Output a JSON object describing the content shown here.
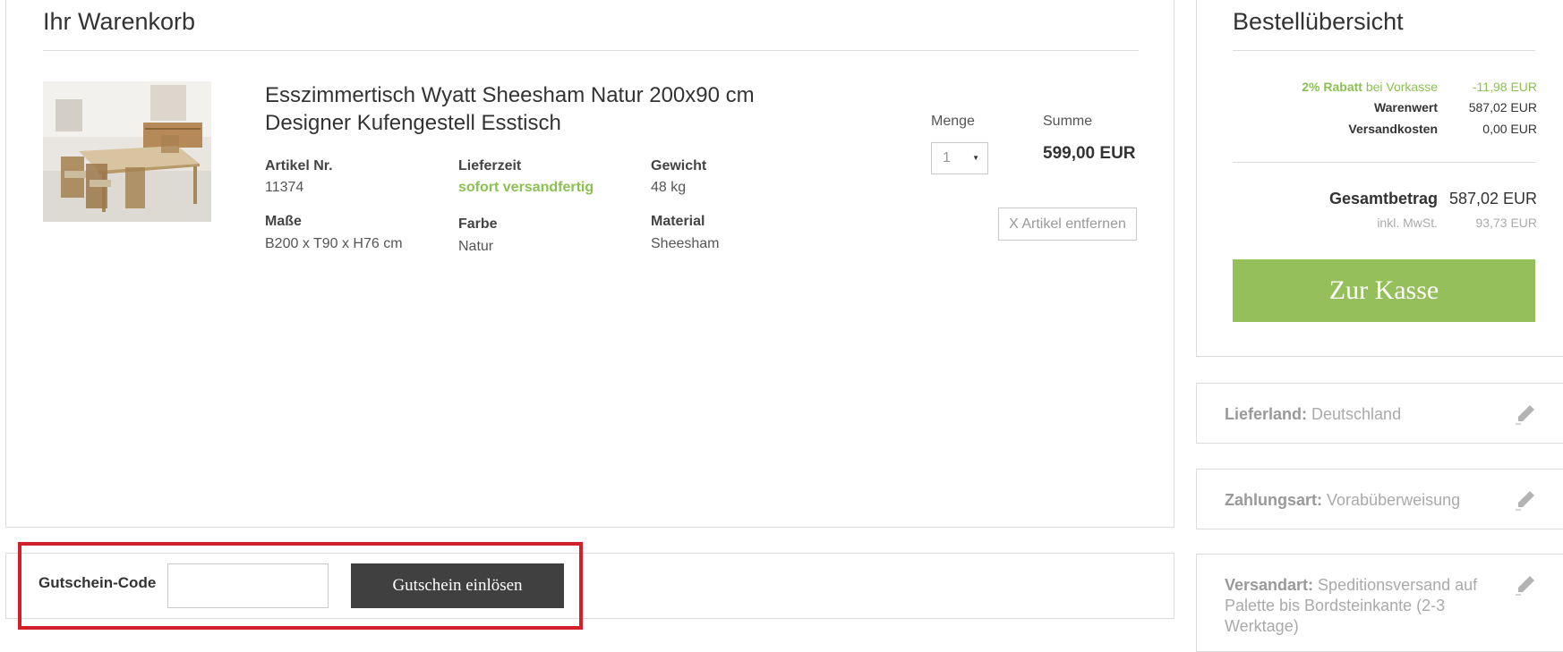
{
  "cart": {
    "title": "Ihr Warenkorb",
    "item": {
      "name": "Esszimmertisch Wyatt Sheesham Natur 200x90 cm Designer Kufengestell Esstisch",
      "attributes": {
        "article_no": {
          "label": "Artikel Nr.",
          "value": "11374"
        },
        "delivery": {
          "label": "Lieferzeit",
          "value": "sofort versandfertig"
        },
        "weight": {
          "label": "Gewicht",
          "value": "48 kg"
        },
        "dimensions": {
          "label": "Maße",
          "value": "B200 x T90 x H76 cm"
        },
        "color": {
          "label": "Farbe",
          "value": "Natur"
        },
        "material": {
          "label": "Material",
          "value": "Sheesham"
        }
      },
      "quantity_label": "Menge",
      "quantity_value": "1",
      "sum_label": "Summe",
      "sum_value": "599,00 EUR",
      "remove_label": "X Artikel entfernen"
    }
  },
  "coupon": {
    "label": "Gutschein-Code",
    "input_value": "",
    "button_label": "Gutschein einlösen"
  },
  "summary": {
    "title": "Bestellübersicht",
    "discount_strong": "2% Rabatt",
    "discount_suffix": " bei Vorkasse",
    "discount_value": "-11,98 EUR",
    "goods_label": "Warenwert",
    "goods_value": "587,02 EUR",
    "shipping_label": "Versandkosten",
    "shipping_value": "0,00 EUR",
    "total_label": "Gesamtbetrag",
    "total_value": "587,02 EUR",
    "vat_label": "inkl. MwSt.",
    "vat_value": "93,73 EUR",
    "checkout_label": "Zur Kasse"
  },
  "info": {
    "country_label": "Lieferland:",
    "country_value": " Deutschland",
    "payment_label": "Zahlungsart:",
    "payment_value": " Vorabüberweisung",
    "shipping_method_label": "Versandart:",
    "shipping_method_value": " Speditionsversand auf Palette bis Bordsteinkante (2-3 Werktage)"
  },
  "colors": {
    "accent_green": "#94bf5a",
    "text_green": "#8cc152",
    "dark_button": "#404040",
    "highlight_red": "#d2202b"
  },
  "icons": [
    "chevron-down-icon",
    "pencil-icon"
  ]
}
